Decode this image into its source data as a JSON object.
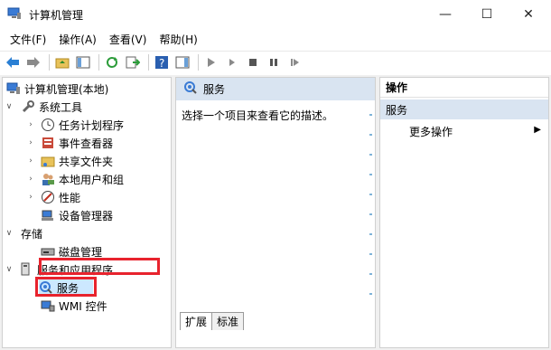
{
  "window": {
    "title": "计算机管理",
    "min_icon": "minimize-icon",
    "max_icon": "maximize-icon",
    "close_icon": "close-icon"
  },
  "menu": [
    "文件(F)",
    "操作(A)",
    "查看(V)",
    "帮助(H)"
  ],
  "toolbar": {
    "icons": [
      "back-arrow-icon",
      "forward-arrow-icon",
      "up-folder-icon",
      "show-hide-tree-icon",
      "refresh-icon",
      "export-list-icon",
      "help-icon",
      "show-hide-action-pane-icon",
      "play-icon",
      "play-small-icon",
      "stop-icon",
      "pause-icon",
      "restart-icon"
    ]
  },
  "tree": {
    "root": "计算机管理(本地)",
    "system_tools": "系统工具",
    "task_scheduler": "任务计划程序",
    "event_viewer": "事件查看器",
    "shared_folders": "共享文件夹",
    "local_users": "本地用户和组",
    "performance": "性能",
    "device_manager": "设备管理器",
    "storage": "存储",
    "disk_management": "磁盘管理",
    "services_apps": "服务和应用程序",
    "services": "服务",
    "wmi": "WMI 控件"
  },
  "middle": {
    "header": "服务",
    "description": "选择一个项目来查看它的描述。",
    "tabs": [
      "扩展",
      "标准"
    ]
  },
  "actions": {
    "header": "操作",
    "section": "服务",
    "more": "更多操作"
  },
  "colors": {
    "highlight": "#e8232d",
    "header_bg": "#d9e4f1",
    "selected_bg": "#cce8ff"
  }
}
